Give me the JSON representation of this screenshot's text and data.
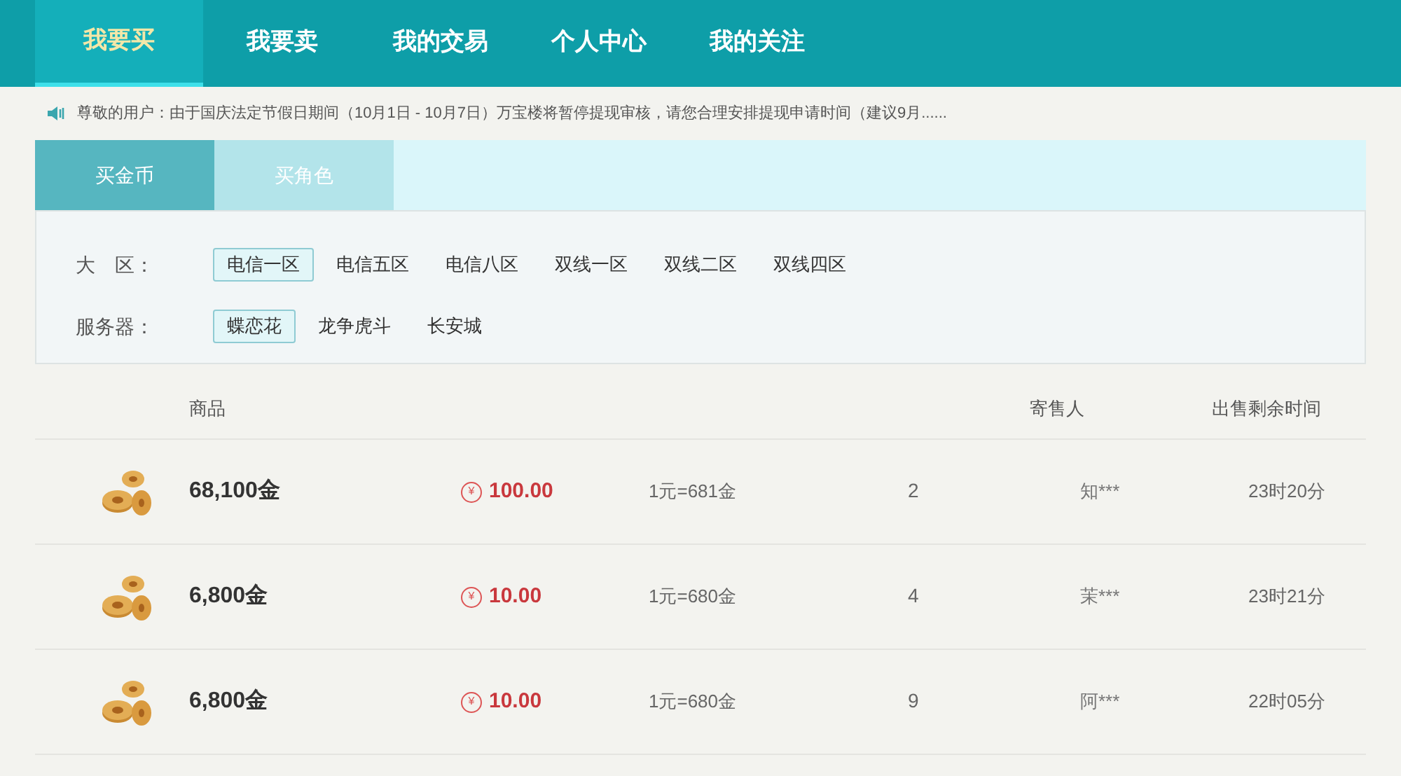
{
  "nav": [
    {
      "label": "我要买",
      "selected": true
    },
    {
      "label": "我要卖",
      "selected": false
    },
    {
      "label": "我的交易",
      "selected": false
    },
    {
      "label": "个人中心",
      "selected": false
    },
    {
      "label": "我的关注",
      "selected": false
    }
  ],
  "notice": "尊敬的用户：由于国庆法定节假日期间（10月1日 - 10月7日）万宝楼将暂停提现审核，请您合理安排提现申请时间（建议9月......",
  "subtabs": [
    {
      "label": "买金币",
      "selected": true
    },
    {
      "label": "买角色",
      "selected": false
    }
  ],
  "filters": [
    {
      "label": "大　区：",
      "options": [
        {
          "label": "电信一区",
          "selected": true
        },
        {
          "label": "电信五区",
          "selected": false
        },
        {
          "label": "电信八区",
          "selected": false
        },
        {
          "label": "双线一区",
          "selected": false
        },
        {
          "label": "双线二区",
          "selected": false
        },
        {
          "label": "双线四区",
          "selected": false
        }
      ]
    },
    {
      "label": "服务器：",
      "options": [
        {
          "label": "蝶恋花",
          "selected": true
        },
        {
          "label": "龙争虎斗",
          "selected": false
        },
        {
          "label": "长安城",
          "selected": false
        }
      ]
    }
  ],
  "table": {
    "columns": {
      "column_1": "商品",
      "column_5": "寄售人",
      "column_6": "出售剩余时间"
    },
    "rows": [
      {
        "amount": "68,100金",
        "currency": "¥",
        "price": "100.00",
        "ratio": "1元=681金",
        "count": "2",
        "seller": "知***",
        "time": "23时20分"
      },
      {
        "amount": "6,800金",
        "currency": "¥",
        "price": "10.00",
        "ratio": "1元=680金",
        "count": "4",
        "seller": "茉***",
        "time": "23时21分"
      },
      {
        "amount": "6,800金",
        "currency": "¥",
        "price": "10.00",
        "ratio": "1元=680金",
        "count": "9",
        "seller": "阿***",
        "time": "22时05分"
      }
    ]
  }
}
